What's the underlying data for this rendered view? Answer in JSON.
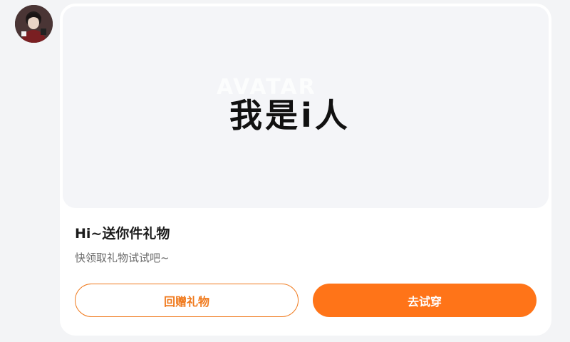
{
  "avatar": {
    "icon": "user-avatar-photo"
  },
  "gift_card": {
    "banner_text": "我是i人",
    "watermark_text": "AVATAR",
    "title": "Hi~送你件礼物",
    "subtitle": "快领取礼物试试吧~",
    "buttons": {
      "return_gift": "回赠礼物",
      "try_on": "去试穿"
    }
  },
  "colors": {
    "accent": "#ff7418",
    "accent_border": "#f07a1d",
    "card_bg": "#ffffff",
    "banner_bg": "#f4f5f8",
    "page_bg": "#f3f4f6"
  }
}
